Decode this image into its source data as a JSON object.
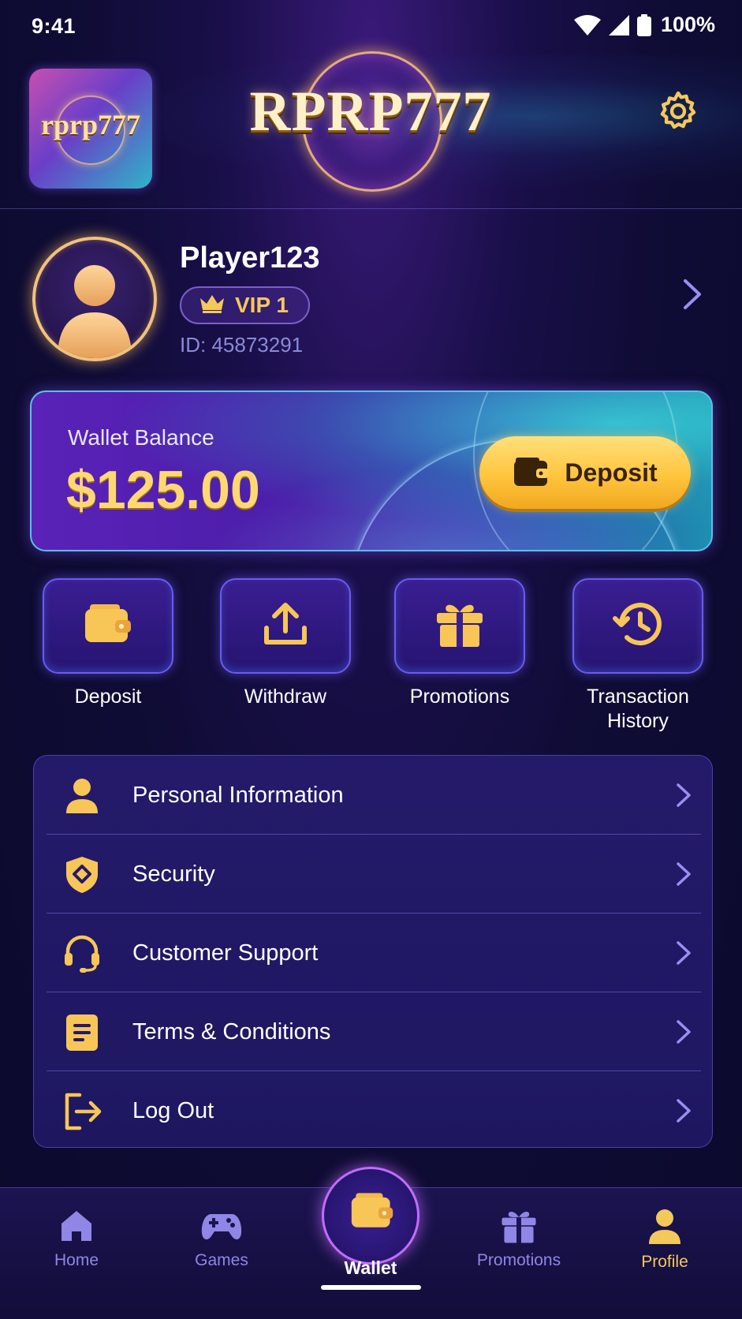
{
  "status_bar": {
    "time": "9:41",
    "battery": "100%"
  },
  "header": {
    "app_logo_text": "rprp777",
    "brand_title": "RPRP777"
  },
  "profile": {
    "username": "Player123",
    "vip_level": "VIP 1",
    "player_id": "ID: 45873291"
  },
  "wallet": {
    "label": "Wallet Balance",
    "amount": "$125.00",
    "deposit_label": "Deposit"
  },
  "quick_actions": [
    {
      "label": "Deposit",
      "icon": "wallet-icon"
    },
    {
      "label": "Withdraw",
      "icon": "upload-icon"
    },
    {
      "label": "Promotions",
      "icon": "gift-icon"
    },
    {
      "label_line1": "Transaction",
      "label_line2": "History",
      "icon": "history-icon"
    }
  ],
  "menu": [
    {
      "label": "Personal Information",
      "icon": "person-icon"
    },
    {
      "label": "Security",
      "icon": "shield-icon"
    },
    {
      "label": "Customer Support",
      "icon": "headset-icon"
    },
    {
      "label": "Terms & Conditions",
      "icon": "document-icon"
    },
    {
      "label": "Log Out",
      "icon": "logout-icon"
    }
  ],
  "bottom_nav": [
    {
      "label": "Home",
      "icon": "home-icon"
    },
    {
      "label": "Games",
      "icon": "gamepad-icon"
    },
    {
      "label": "Wallet",
      "icon": "wallet-icon"
    },
    {
      "label": "Promotions",
      "icon": "gift-icon"
    },
    {
      "label": "Profile",
      "icon": "person-icon"
    }
  ],
  "colors": {
    "accent_gold": "#f5c85a",
    "background": "#0f0c35",
    "card_border_cyan": "#56c2e8",
    "nav_inactive": "#8f86e6"
  }
}
